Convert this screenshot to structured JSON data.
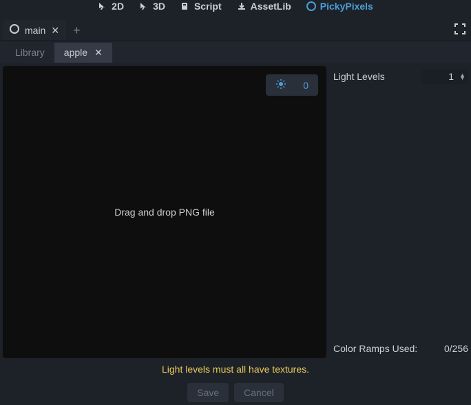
{
  "topMenu": {
    "item2d": "2D",
    "item3d": "3D",
    "script": "Script",
    "assetLib": "AssetLib",
    "pickyPixels": "PickyPixels"
  },
  "sceneTab": {
    "name": "main"
  },
  "subTabs": {
    "library": "Library",
    "apple": "apple"
  },
  "preview": {
    "lightValue": "0",
    "dropText": "Drag and drop PNG file"
  },
  "rightPanel": {
    "lightLevelsLabel": "Light Levels",
    "lightLevelsValue": "1",
    "rampsLabel": "Color Ramps Used:",
    "rampsValue": "0/256"
  },
  "warning": "Light levels must all have textures.",
  "buttons": {
    "save": "Save",
    "cancel": "Cancel"
  }
}
